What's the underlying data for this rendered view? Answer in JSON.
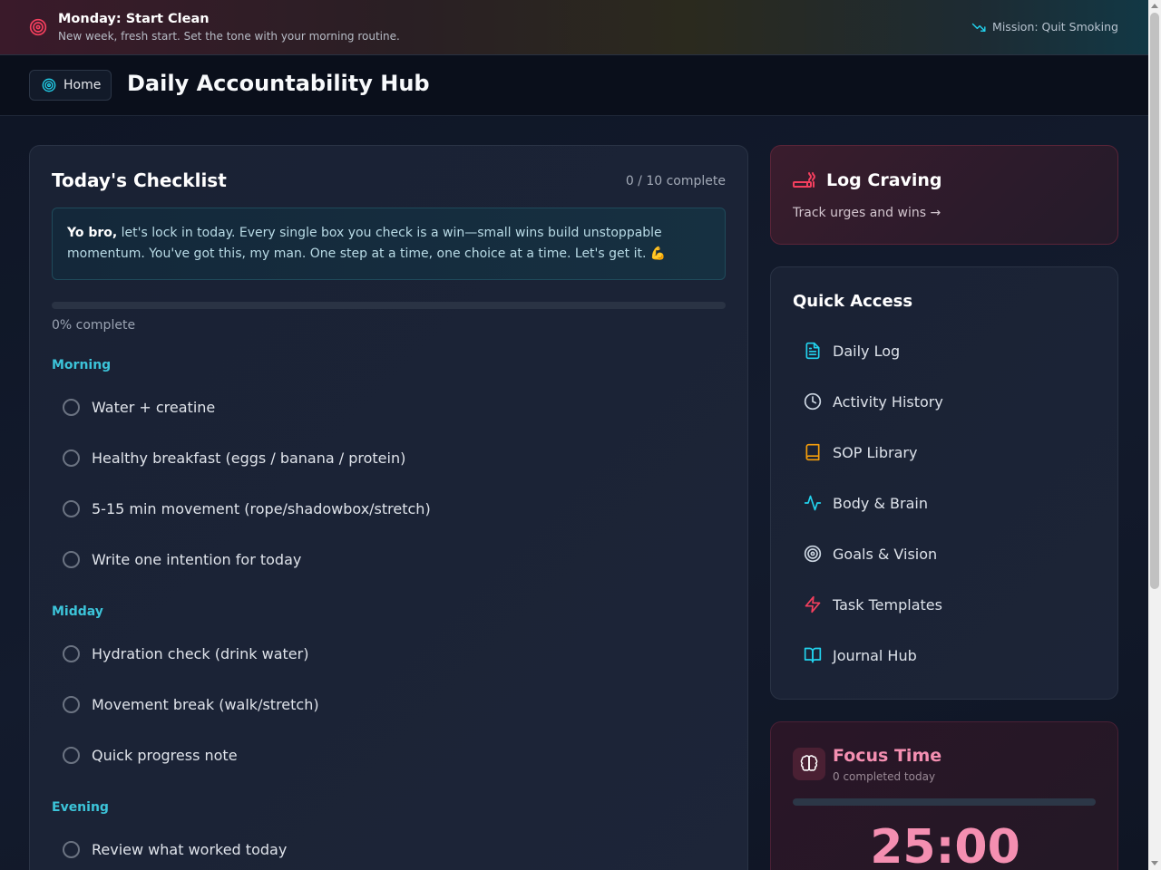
{
  "banner": {
    "title": "Monday: Start Clean",
    "subtitle": "New week, fresh start. Set the tone with your morning routine.",
    "mission": "Mission: Quit Smoking",
    "icon": "target-icon",
    "mission_icon": "trending-down-icon"
  },
  "header": {
    "home_label": "Home",
    "title": "Daily Accountability Hub"
  },
  "checklist": {
    "title": "Today's Checklist",
    "count": "0 / 10 complete",
    "motivation_lead": "Yo bro,",
    "motivation_text": " let's lock in today. Every single box you check is a win—small wins build unstoppable momentum. You've got this, my man. One step at a time, one choice at a time. Let's get it. 💪",
    "progress": 0,
    "progress_text": "0% complete",
    "sections": [
      {
        "label": "Morning",
        "tasks": [
          "Water + creatine",
          "Healthy breakfast (eggs / banana / protein)",
          "5-15 min movement (rope/shadowbox/stretch)",
          "Write one intention for today"
        ]
      },
      {
        "label": "Midday",
        "tasks": [
          "Hydration check (drink water)",
          "Movement break (walk/stretch)",
          "Quick progress note"
        ]
      },
      {
        "label": "Evening",
        "tasks": [
          "Review what worked today"
        ]
      }
    ]
  },
  "craving": {
    "title": "Log Craving",
    "subtitle": "Track urges and wins →",
    "icon": "cigarette-icon"
  },
  "quick_access": {
    "title": "Quick Access",
    "items": [
      {
        "label": "Daily Log",
        "icon": "file-text-icon",
        "color": "#22d3ee"
      },
      {
        "label": "Activity History",
        "icon": "clock-icon",
        "color": "#cbd5e1"
      },
      {
        "label": "SOP Library",
        "icon": "book-icon",
        "color": "#f59e0b"
      },
      {
        "label": "Body & Brain",
        "icon": "activity-icon",
        "color": "#22d3ee"
      },
      {
        "label": "Goals & Vision",
        "icon": "target-icon",
        "color": "#cbd5e1"
      },
      {
        "label": "Task Templates",
        "icon": "zap-icon",
        "color": "#f43f5e"
      },
      {
        "label": "Journal Hub",
        "icon": "book-open-icon",
        "color": "#22d3ee"
      }
    ]
  },
  "focus": {
    "title": "Focus Time",
    "subtitle": "0 completed today",
    "timer": "25:00",
    "progress": 0,
    "icon": "brain-icon"
  },
  "colors": {
    "accent": "#22d3ee",
    "rose": "#f43f5e",
    "pink": "#f48fb1"
  }
}
